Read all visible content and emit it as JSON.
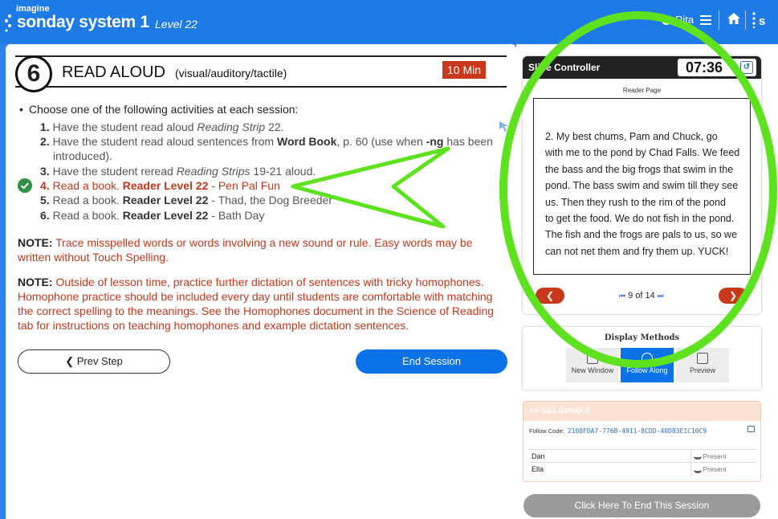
{
  "topbar": {
    "brand_top": "imagine",
    "brand_main": "sonday system 1",
    "level": "Level 22",
    "user_name": "Rita",
    "icons": [
      "sonday-logo-icon",
      "user-ring-icon",
      "menu-icon",
      "home-icon",
      "s-logo-icon"
    ]
  },
  "step": {
    "number": "6",
    "title": "READ ALOUD",
    "subtitle": "(visual/auditory/tactile)",
    "time": "10 Min"
  },
  "activities": {
    "header": "Choose one of the following activities at each session:",
    "items": [
      {
        "num": "1.",
        "pre": "Have the student read aloud ",
        "em": "Reading Strip",
        "post": " 22."
      },
      {
        "num": "2.",
        "pre": "Have the student read aloud sentences from ",
        "bold": "Word Book",
        "post": ", p. 60 (use when ",
        "bold2": "-ng",
        "post2": " has been",
        "line2": "introduced)."
      },
      {
        "num": "3.",
        "pre": "Have the student reread ",
        "em": "Reading Strips",
        "post": " 19-21 aloud."
      },
      {
        "num": "4.",
        "pre": "Read a book. ",
        "bold": "Reader Level 22",
        "post": " - Pen Pal Fun",
        "selected": true
      },
      {
        "num": "5.",
        "pre": "Read a book. ",
        "bold": "Reader Level 22",
        "post": " - Thad, the Dog Breeder"
      },
      {
        "num": "6.",
        "pre": "Read a book. ",
        "bold": "Reader Level 22",
        "post": " - Bath Day"
      }
    ]
  },
  "notes": [
    {
      "label": "NOTE:",
      "line1": " Trace misspelled words or words involving a new sound or rule. Easy words may be",
      "line2": "written without Touch Spelling."
    },
    {
      "label": "NOTE:",
      "line1": " Outside of lesson time, practice further dictation of sentences with tricky homophones.",
      "line2": "Homophone practice should be included every day until students are comfortable with matching",
      "line3": "the correct spelling to the meanings. See the Homophones document in the Science of Reading",
      "line4": "tab for instructions on teaching homophones and example dictation sentences."
    }
  ],
  "buttons": {
    "prev_step": "Prev Step",
    "end_session": "End Session",
    "end_here": "Click Here To End This Session"
  },
  "slide": {
    "title": "Slide Controller",
    "timer": "07:36",
    "reader_label": "Reader Page",
    "text_lines": [
      "2.   My best chums, Pam and Chuck, go",
      "with me to the pond by Chad Falls. We feed",
      "the bass and the big frogs that swim in the",
      "pond. The bass swim and swim till they see",
      "us. Then they rush to the rim of the pond",
      "to get the food. We do not fish in the pond.",
      "The fish and the frogs are pals to us, so we",
      "can not net them and fry them up. YUCK!"
    ],
    "page": "9 of 14"
  },
  "display": {
    "title": "Display Methods",
    "methods": [
      {
        "label": "New Window",
        "active": false
      },
      {
        "label": "Follow Along",
        "active": true
      },
      {
        "label": "Preview",
        "active": false
      }
    ]
  },
  "group": {
    "name": "SS1 Group 3",
    "follow_label": "Follow Code:",
    "follow_code": "2108FDA7-776B-4911-8CDD-40D83E1C10C9",
    "students": [
      {
        "name": "Dan",
        "status": "Present"
      },
      {
        "name": "Ella",
        "status": "Present"
      }
    ]
  },
  "colors": {
    "topbar": "#1e7be6",
    "accent_red": "#c9381a",
    "primary_blue": "#0b72e7",
    "annotation_green": "#5ee11e",
    "check_green": "#2e9146"
  }
}
